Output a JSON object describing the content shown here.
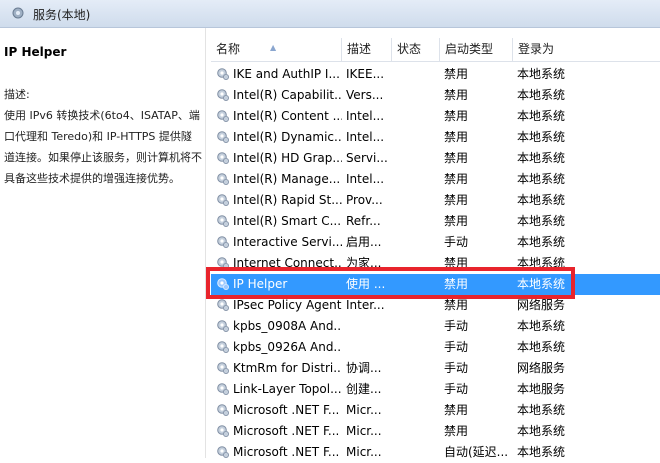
{
  "window": {
    "title": "服务(本地)"
  },
  "description_panel": {
    "service_name": "IP Helper",
    "description_label": "描述:",
    "description_text": "使用 IPv6 转换技术(6to4、ISATAP、端口代理和 Teredo)和 IP-HTTPS 提供隧道连接。如果停止该服务，则计算机将不具备这些技术提供的增强连接优势。"
  },
  "columns": [
    "名称",
    "描述",
    "状态",
    "启动类型",
    "登录为"
  ],
  "rows": [
    {
      "name": "IKE and AuthIP I...",
      "desc": "IKEE...",
      "status": "",
      "startup": "禁用",
      "logon": "本地系统"
    },
    {
      "name": "Intel(R) Capabilit...",
      "desc": "Vers...",
      "status": "",
      "startup": "禁用",
      "logon": "本地系统"
    },
    {
      "name": "Intel(R) Content ...",
      "desc": "Intel...",
      "status": "",
      "startup": "禁用",
      "logon": "本地系统"
    },
    {
      "name": "Intel(R) Dynamic...",
      "desc": "Intel...",
      "status": "",
      "startup": "禁用",
      "logon": "本地系统"
    },
    {
      "name": "Intel(R) HD Grap...",
      "desc": "Servi...",
      "status": "",
      "startup": "禁用",
      "logon": "本地系统"
    },
    {
      "name": "Intel(R) Manage...",
      "desc": "Intel...",
      "status": "",
      "startup": "禁用",
      "logon": "本地系统"
    },
    {
      "name": "Intel(R) Rapid St...",
      "desc": "Prov...",
      "status": "",
      "startup": "禁用",
      "logon": "本地系统"
    },
    {
      "name": "Intel(R) Smart C...",
      "desc": "Refr...",
      "status": "",
      "startup": "禁用",
      "logon": "本地系统"
    },
    {
      "name": "Interactive Servi...",
      "desc": "启用...",
      "status": "",
      "startup": "手动",
      "logon": "本地系统"
    },
    {
      "name": "Internet Connect...",
      "desc": "为家...",
      "status": "",
      "startup": "禁用",
      "logon": "本地系统"
    },
    {
      "name": "IP Helper",
      "desc": "使用 ...",
      "status": "",
      "startup": "禁用",
      "logon": "本地系统",
      "selected": true
    },
    {
      "name": "IPsec Policy Agent",
      "desc": "Inter...",
      "status": "",
      "startup": "禁用",
      "logon": "网络服务"
    },
    {
      "name": "kpbs_0908A And...",
      "desc": "",
      "status": "",
      "startup": "手动",
      "logon": "本地系统"
    },
    {
      "name": "kpbs_0926A And...",
      "desc": "",
      "status": "",
      "startup": "手动",
      "logon": "本地系统"
    },
    {
      "name": "KtmRm for Distri...",
      "desc": "协调...",
      "status": "",
      "startup": "手动",
      "logon": "网络服务"
    },
    {
      "name": "Link-Layer Topol...",
      "desc": "创建...",
      "status": "",
      "startup": "手动",
      "logon": "本地服务"
    },
    {
      "name": "Microsoft .NET F...",
      "desc": "Micr...",
      "status": "",
      "startup": "禁用",
      "logon": "本地系统"
    },
    {
      "name": "Microsoft .NET F...",
      "desc": "Micr...",
      "status": "",
      "startup": "禁用",
      "logon": "本地系统"
    },
    {
      "name": "Microsoft .NET F...",
      "desc": "Micr...",
      "status": "",
      "startup": "自动(延迟...",
      "logon": "本地系统"
    }
  ],
  "icons": {
    "service": "gear-icon",
    "sort": "sort-ascending-icon"
  },
  "colors": {
    "selection": "#3399ff",
    "highlight_border": "#e8242c",
    "header_bg": "#dfe8f5"
  }
}
